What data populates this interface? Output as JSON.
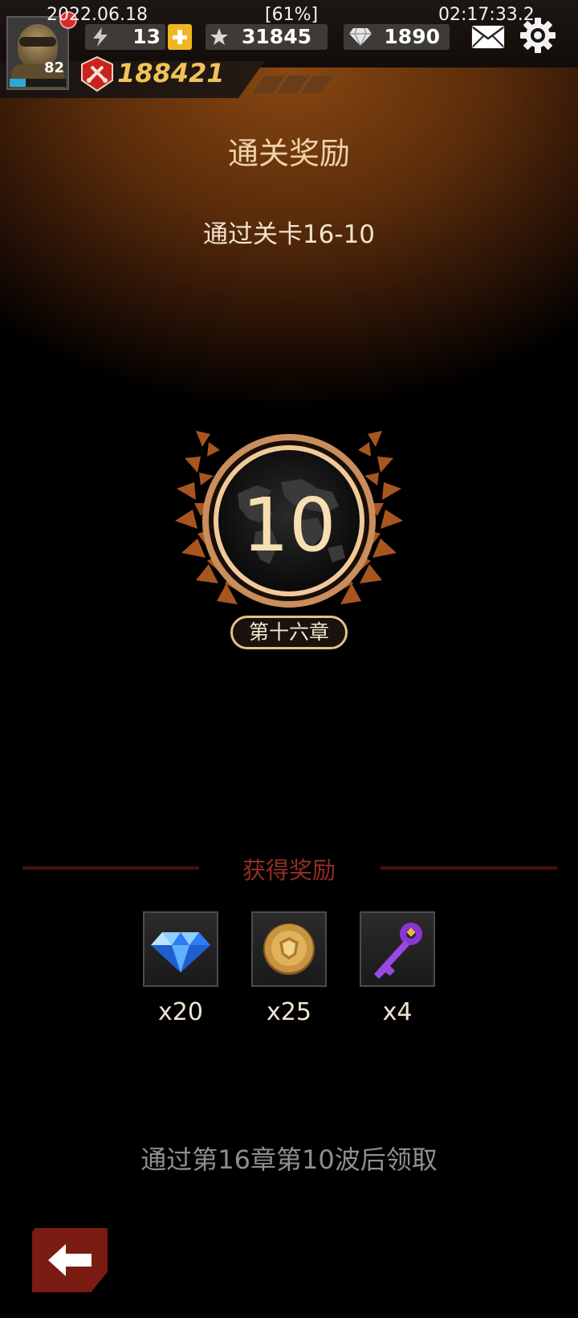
{
  "status_bar": {
    "date": "2022.06.18",
    "battery": "[61%]",
    "time": "02:17:33.2"
  },
  "player": {
    "level": "82",
    "xp_fraction": 0.28,
    "power": "188421"
  },
  "resources": {
    "energy": "13",
    "stars": "31845",
    "gems": "1890"
  },
  "header": {
    "title": "通关奖励",
    "subtitle": "通过关卡16-10"
  },
  "emblem": {
    "stage_number": "10",
    "chapter": "第十六章"
  },
  "rewards": {
    "title": "获得奖励",
    "items": [
      {
        "icon": "diamond-icon",
        "qty": "x20"
      },
      {
        "icon": "gold-coin-icon",
        "qty": "x25"
      },
      {
        "icon": "purple-key-icon",
        "qty": "x4"
      }
    ]
  },
  "claim_note": "通过第16章第10波后领取",
  "colors": {
    "accent_gold": "#f2c25a",
    "reward_title": "#8f2f22",
    "back_button": "#7a1c12"
  }
}
